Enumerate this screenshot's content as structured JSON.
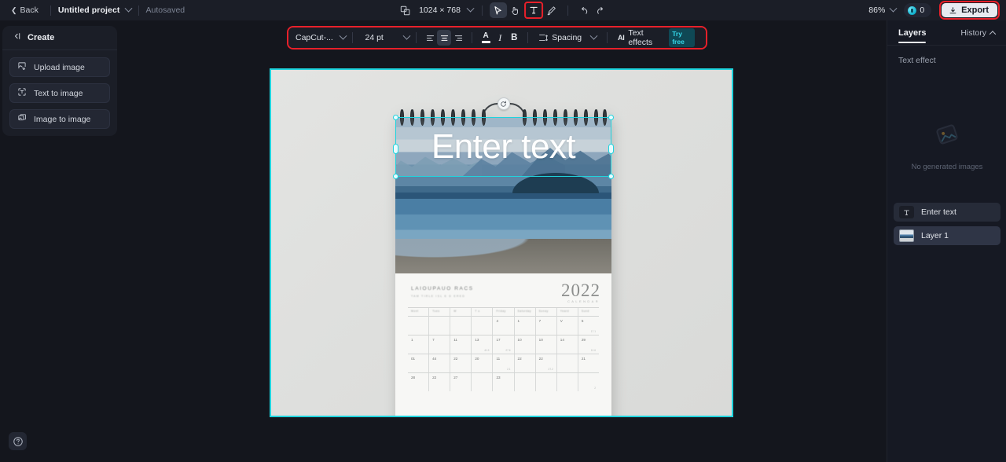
{
  "topbar": {
    "back_label": "Back",
    "project_name": "Untitled project",
    "autosaved_label": "Autosaved",
    "canvas_size": "1024 × 768",
    "zoom_level": "86%",
    "credits_count": "0",
    "export_label": "Export",
    "tools": [
      {
        "name": "resize-icon",
        "label": "Resize"
      },
      {
        "name": "select-tool",
        "label": "Select"
      },
      {
        "name": "hand-tool",
        "label": "Hand"
      },
      {
        "name": "text-tool",
        "label": "Text"
      },
      {
        "name": "brush-tool",
        "label": "Brush"
      },
      {
        "name": "undo-button",
        "label": "Undo"
      },
      {
        "name": "redo-button",
        "label": "Redo"
      }
    ]
  },
  "text_toolbar": {
    "font_family": "CapCut-...",
    "font_size": "24 pt",
    "align_left": "Align left",
    "align_center": "Align center",
    "align_right": "Align right",
    "text_color": "A",
    "italic": "I",
    "bold": "B",
    "spacing_label": "Spacing",
    "effects_label": "Text effects",
    "try_free_label": "Try free",
    "highlight_color": "#e8202a",
    "accent_color": "#35d6e8"
  },
  "left_panel": {
    "title": "Create",
    "items": [
      {
        "label": "Upload image",
        "icon": "upload-image-icon"
      },
      {
        "label": "Text to image",
        "icon": "text-to-image-icon"
      },
      {
        "label": "Image to image",
        "icon": "image-to-image-icon"
      }
    ]
  },
  "right_panel": {
    "layers_tab": "Layers",
    "history_tab": "History",
    "section_label": "Text effect",
    "empty_text": "No generated images",
    "layers": [
      {
        "label": "Enter text",
        "icon": "text-layer-icon",
        "selected": false
      },
      {
        "label": "Layer 1",
        "icon": "image-layer-thumbnail",
        "selected": true
      }
    ]
  },
  "canvas": {
    "text_element": "Enter text",
    "selection_color": "#1fd4de",
    "artboard_color": "#e0e1e0"
  },
  "calendar": {
    "year": "2022",
    "year_sub": "CALENDAR",
    "title": "LAIOUPAUO RACS",
    "subtitle": "TAM TIRLE ISL E D ERED",
    "day_headers": [
      "Mont",
      "Tues",
      "W",
      "T u",
      "Friday",
      "Saturday",
      "Sunay",
      "Yeard",
      "Sund"
    ],
    "rows": [
      {
        "nums": [
          "",
          "",
          "",
          "",
          "4",
          "1",
          "7",
          "V",
          "5"
        ],
        "notes": [
          "",
          "",
          "",
          "",
          "",
          "",
          "",
          "",
          "17.1"
        ]
      },
      {
        "nums": [
          "1",
          "7",
          "11",
          "13",
          "17",
          "10",
          "10",
          "14",
          "29"
        ],
        "notes": [
          "",
          "",
          "",
          "41.9",
          "27.6",
          "",
          "",
          "",
          "12.6"
        ]
      },
      {
        "nums": [
          "01",
          "44",
          "22",
          "20",
          "11",
          "22",
          "22",
          "",
          "21"
        ],
        "notes": [
          "",
          "",
          "",
          "",
          "2.1",
          "",
          "27.2",
          "",
          ""
        ]
      },
      {
        "nums": [
          "28",
          "22",
          "27",
          "",
          "23",
          "",
          "",
          "",
          ""
        ],
        "notes": [
          "",
          "",
          "",
          "",
          "",
          "",
          "",
          "",
          "2"
        ]
      }
    ]
  },
  "help": {
    "label": "?"
  }
}
